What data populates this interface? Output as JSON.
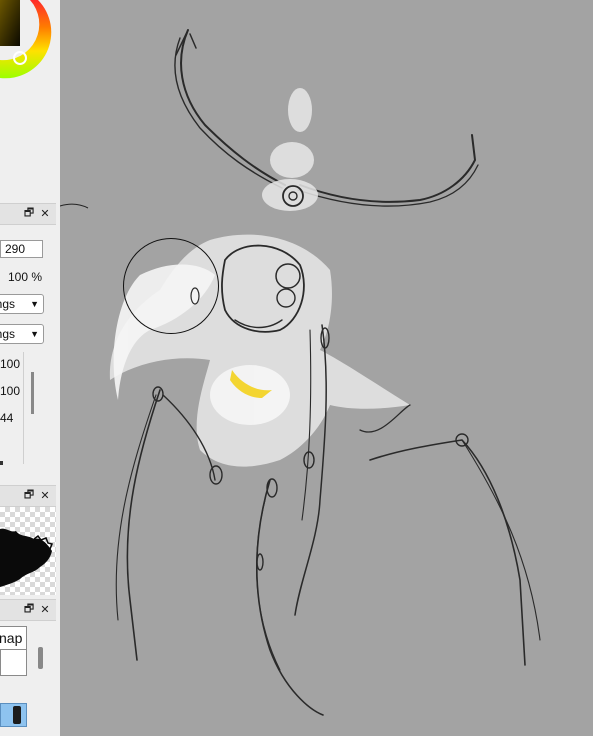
{
  "panels": {
    "brush": {
      "size_value": "290",
      "opacity_value": "100 %",
      "blend_dropdown_1": "ings",
      "blend_dropdown_2": "ings",
      "slider_values": [
        "100",
        "100",
        "44"
      ]
    },
    "tool": {
      "tab_label": "nap"
    },
    "dock_icons": {
      "float": "🗗",
      "close": "✕"
    }
  },
  "colors": {
    "canvas_bg": "#a3a3a3",
    "sidebar_bg": "#efefef",
    "highlight_yellow": "#f3d21c",
    "selected_layer": "#8ec3ef"
  }
}
